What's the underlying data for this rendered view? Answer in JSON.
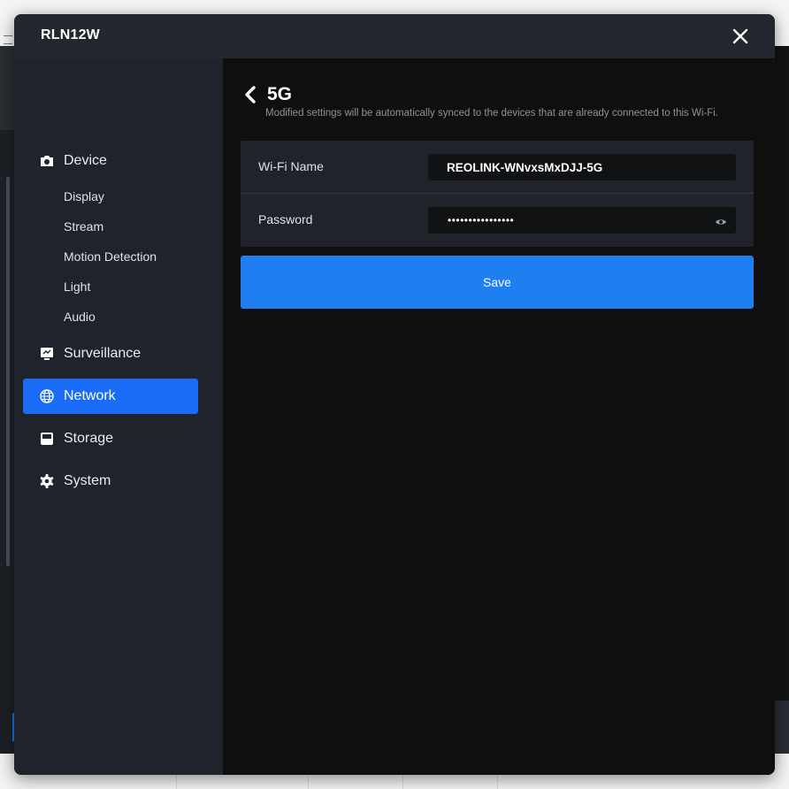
{
  "window": {
    "title": "RLN12W"
  },
  "sidebar": {
    "items": [
      {
        "label": "Device",
        "icon": "camera-icon"
      },
      {
        "label": "Surveillance",
        "icon": "monitor-icon"
      },
      {
        "label": "Network",
        "icon": "globe-icon",
        "active": true
      },
      {
        "label": "Storage",
        "icon": "storage-icon"
      },
      {
        "label": "System",
        "icon": "gear-icon"
      }
    ],
    "device_subitems": [
      "Display",
      "Stream",
      "Motion Detection",
      "Light",
      "Audio"
    ]
  },
  "page": {
    "title": "5G",
    "description": "Modified settings will be automatically synced to the devices that are already connected to this Wi-Fi."
  },
  "form": {
    "wifi_name": {
      "label": "Wi-Fi Name",
      "value": "REOLINK-WNvxsMxDJJ-5G"
    },
    "password": {
      "label": "Password",
      "value": "••••••••••••••••"
    }
  },
  "actions": {
    "save_label": "Save"
  },
  "colors": {
    "accent": "#1a6cf6",
    "save_button": "#1f7ef0"
  }
}
